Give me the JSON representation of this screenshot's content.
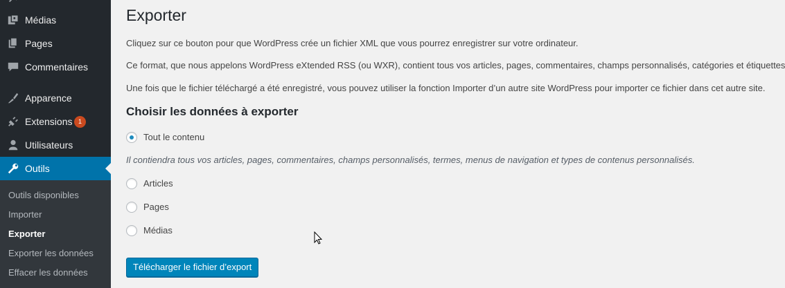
{
  "sidebar": {
    "menu": [
      {
        "label": "Médias",
        "icon": "media-icon"
      },
      {
        "label": "Pages",
        "icon": "pages-icon"
      },
      {
        "label": "Commentaires",
        "icon": "comments-icon"
      },
      {
        "label": "Apparence",
        "icon": "appearance-icon"
      },
      {
        "label": "Extensions",
        "icon": "plugins-icon",
        "badge": "1"
      },
      {
        "label": "Utilisateurs",
        "icon": "users-icon"
      },
      {
        "label": "Outils",
        "icon": "tools-icon",
        "current": true
      }
    ],
    "submenu": [
      {
        "label": "Outils disponibles"
      },
      {
        "label": "Importer"
      },
      {
        "label": "Exporter",
        "current": true
      },
      {
        "label": "Exporter les données"
      },
      {
        "label": "Effacer les données"
      }
    ]
  },
  "main": {
    "title": "Exporter",
    "paragraphs": [
      "Cliquez sur ce bouton pour que WordPress crée un fichier XML que vous pourrez enregistrer sur votre ordinateur.",
      "Ce format, que nous appelons WordPress eXtended RSS (ou WXR), contient tous vos articles, pages, commentaires, champs personnalisés, catégories et étiquettes.",
      "Une fois que le fichier téléchargé a été enregistré, vous pouvez utiliser la fonction Importer d’un autre site WordPress pour importer ce fichier dans cet autre site."
    ],
    "section_title": "Choisir les données à exporter",
    "options": [
      {
        "label": "Tout le contenu",
        "checked": true
      },
      {
        "label": "Articles",
        "checked": false
      },
      {
        "label": "Pages",
        "checked": false
      },
      {
        "label": "Médias",
        "checked": false
      }
    ],
    "all_content_description": "Il contiendra tous vos articles, pages, commentaires, champs personnalisés, termes, menus de navigation et types de contenus personnalisés.",
    "download_button": "Télécharger le fichier d’export"
  },
  "colors": {
    "sidebar_bg": "#23282d",
    "submenu_bg": "#32373c",
    "accent": "#0073aa",
    "button": "#0085ba",
    "badge": "#ca4a1f"
  }
}
